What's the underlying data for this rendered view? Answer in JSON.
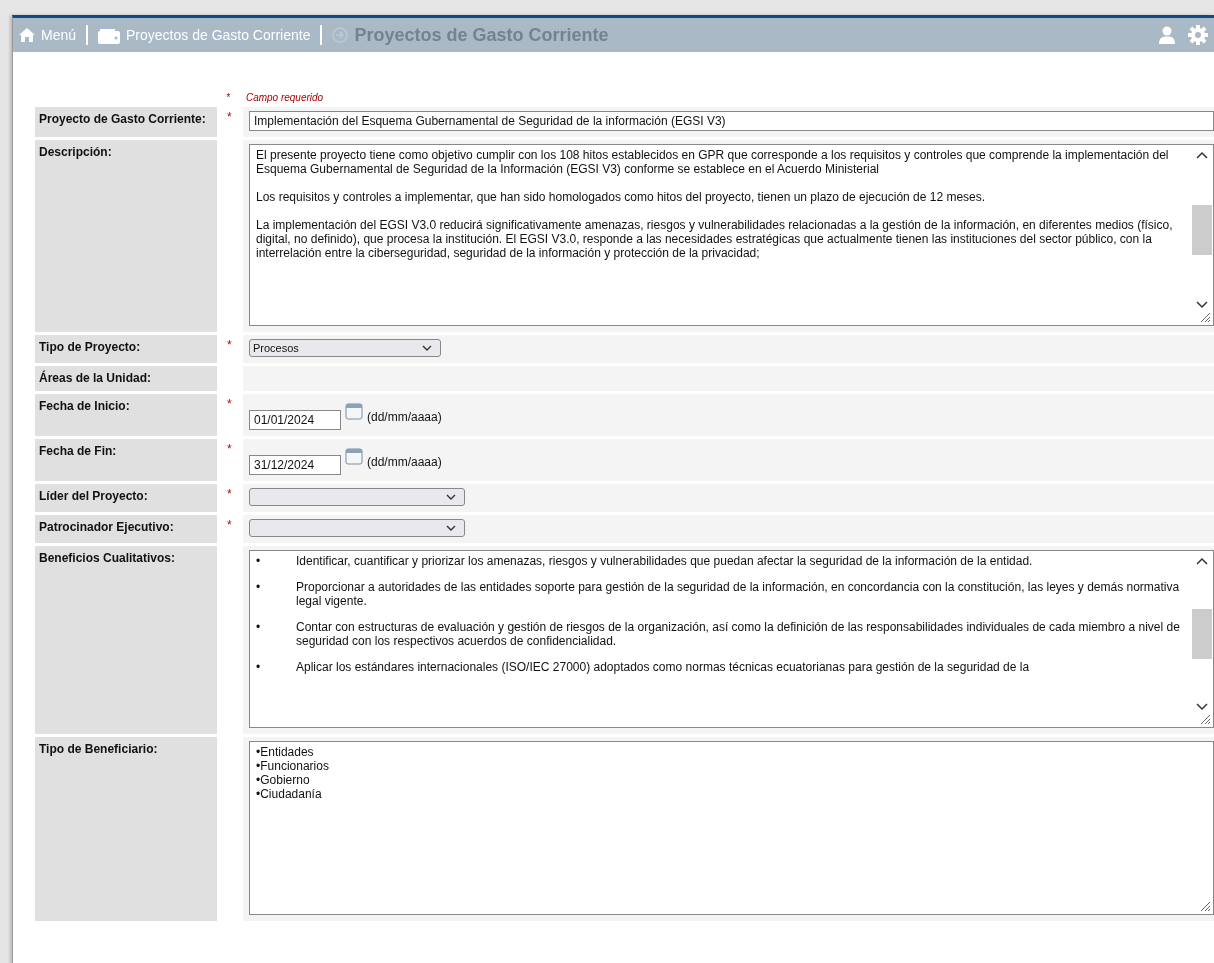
{
  "nav": {
    "menu": "Menú",
    "breadcrumb": "Proyectos de Gasto Corriente",
    "title": "Proyectos de Gasto Corriente"
  },
  "required_note": {
    "mark": "*",
    "text": "Campo requerido"
  },
  "fields": [
    {
      "kind": "text",
      "label": "Proyecto de Gasto Corriente:",
      "required": true,
      "value": "Implementación del Esquema Gubernamental de Seguridad de la información (EGSI V3)"
    },
    {
      "kind": "textarea",
      "label": "Descripción:",
      "required": false,
      "paragraphs": [
        {
          "text": "El presente proyecto tiene como objetivo cumplir con los 108 hitos establecidos en GPR que corresponde a los requisitos y controles que comprende la implementación del Esquema Gubernamental de Seguridad de la Información (EGSI V3) conforme se establece en el Acuerdo Ministerial"
        },
        {
          "text": "Los requisitos y controles a implementar, que han sido homologados como hitos del proyecto, tienen un plazo de ejecución de 12 meses."
        },
        {
          "text": "La implementación del EGSI V3.0 reducirá significativamente amenazas, riesgos y vulnerabilidades relacionadas a la gestión de la información, en diferentes medios (físico, digital, no definido), que procesa la institución. El EGSI V3.0, responde a las necesidades estratégicas que actualmente tienen las instituciones del sector público, con la interrelación entre la ciberseguridad, seguridad de la información y protección de la privacidad;"
        }
      ]
    },
    {
      "kind": "select",
      "label": "Tipo de Proyecto:",
      "required": true,
      "value": "Procesos"
    },
    {
      "kind": "empty",
      "label": "Áreas de la Unidad:",
      "required": false
    },
    {
      "kind": "date",
      "label": "Fecha de Inicio:",
      "required": true,
      "value": "01/01/2024",
      "hint": "(dd/mm/aaaa)"
    },
    {
      "kind": "date",
      "label": "Fecha de Fin:",
      "required": true,
      "value": "31/12/2024",
      "hint": "(dd/mm/aaaa)"
    },
    {
      "kind": "select",
      "label": "Líder del Proyecto:",
      "required": true
    },
    {
      "kind": "select",
      "label": "Patrocinador Ejecutivo:",
      "required": true
    },
    {
      "kind": "textarea",
      "label": "Beneficios Cualitativos:",
      "required": false,
      "paragraphs": [
        {
          "bullet": "•",
          "text": "Identificar, cuantificar y priorizar los amenazas, riesgos y vulnerabilidades que puedan afectar la seguridad de la información de la entidad."
        },
        {
          "bullet": "•",
          "text": "Proporcionar a autoridades de las entidades soporte para gestión de la seguridad de la información, en concordancia con la constitución, las leyes y demás normativa legal vigente."
        },
        {
          "bullet": "•",
          "text": "Contar con estructuras de evaluación y gestión de riesgos de la organización, así como la definición de las responsabilidades individuales de cada miembro a nivel de seguridad con los respectivos acuerdos de confidencialidad."
        },
        {
          "bullet": "•",
          "text": "Aplicar los estándares internacionales (ISO/IEC 27000) adoptados como normas técnicas ecuatorianas para gestión de la seguridad de la"
        }
      ]
    },
    {
      "kind": "list",
      "label": "Tipo de Beneficiario:",
      "required": false,
      "lines": [
        "•Entidades",
        "•Funcionarios",
        "•Gobierno",
        "•Ciudadanía"
      ]
    }
  ]
}
